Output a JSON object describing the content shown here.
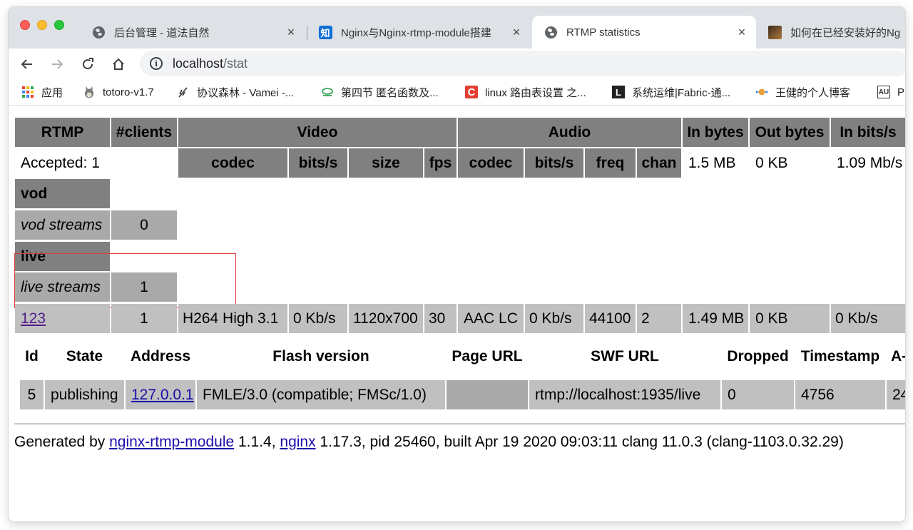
{
  "browser": {
    "tabs": [
      {
        "title": "后台管理 - 道法自然",
        "icon": "globe-icon",
        "active": false
      },
      {
        "title": "Nginx与Nginx-rtmp-module搭建",
        "icon": "zhihu-icon",
        "icon_text": "知",
        "active": false
      },
      {
        "title": "RTMP statistics",
        "icon": "globe-icon",
        "active": true
      },
      {
        "title": "如何在已经安装好的Ng",
        "icon": "avatar-icon",
        "active": false
      }
    ],
    "close_glyph": "×",
    "url_host": "localhost",
    "url_path": "/stat",
    "bookmarks": [
      {
        "label": "应用",
        "icon": "apps-grid-icon"
      },
      {
        "label": "totoro-v1.7",
        "icon": "totoro-icon"
      },
      {
        "label": "协议森林 - Vamei -...",
        "icon": "feather-icon"
      },
      {
        "label": "第四节 匿名函数及...",
        "icon": "cloud-icon"
      },
      {
        "label": "linux 路由表设置 之...",
        "icon": "csdn-icon",
        "icon_text": "C"
      },
      {
        "label": "系统运维|Fabric-通...",
        "icon": "square-logo-icon",
        "icon_text": "L"
      },
      {
        "label": "王健的个人博客",
        "icon": "badge-icon"
      },
      {
        "label": "P",
        "icon": "au-icon",
        "icon_text": "AU"
      }
    ]
  },
  "rtmp": {
    "headers": {
      "rtmp": "RTMP",
      "clients": "#clients",
      "video": "Video",
      "audio": "Audio",
      "in_bytes": "In bytes",
      "out_bytes": "Out bytes",
      "in_bits": "In bits/s"
    },
    "subheaders": {
      "v_codec": "codec",
      "v_bits": "bits/s",
      "v_size": "size",
      "v_fps": "fps",
      "a_codec": "codec",
      "a_bits": "bits/s",
      "a_freq": "freq",
      "a_chan": "chan"
    },
    "accepted": "Accepted: 1",
    "total_in_bytes": "1.5 MB",
    "total_out_bytes": "0 KB",
    "total_in_bits": "1.09 Mb/s",
    "apps": [
      {
        "name": "vod",
        "streams_label": "vod streams",
        "streams": "0"
      },
      {
        "name": "live",
        "streams_label": "live streams",
        "streams": "1"
      }
    ],
    "stream": {
      "name": "123",
      "clients": "1",
      "v_codec": "H264 High 3.1",
      "v_bits": "0 Kb/s",
      "v_size": "1120x700",
      "v_fps": "30",
      "a_codec": "AAC LC",
      "a_bits": "0 Kb/s",
      "a_freq": "44100",
      "a_chan": "2",
      "in_bytes": "1.49 MB",
      "out_bytes": "0 KB",
      "in_bits": "0 Kb/s"
    },
    "client_headers": {
      "id": "Id",
      "state": "State",
      "address": "Address",
      "flash": "Flash version",
      "page_url": "Page URL",
      "swf_url": "SWF URL",
      "dropped": "Dropped",
      "timestamp": "Timestamp",
      "avsync": "A-"
    },
    "client": {
      "id": "5",
      "state": "publishing",
      "address": "127.0.0.1",
      "flash": "FMLE/3.0 (compatible; FMSc/1.0)",
      "page_url": "",
      "swf_url": "rtmp://localhost:1935/live",
      "dropped": "0",
      "timestamp": "4756",
      "avsync": "24"
    }
  },
  "footer": {
    "prefix": "Generated by ",
    "module_link": "nginx-rtmp-module",
    "module_version": " 1.1.4, ",
    "nginx_link": "nginx",
    "rest": " 1.17.3, pid 25460, built Apr 19 2020 09:03:11 clang 11.0.3 (clang-1103.0.32.29)"
  }
}
